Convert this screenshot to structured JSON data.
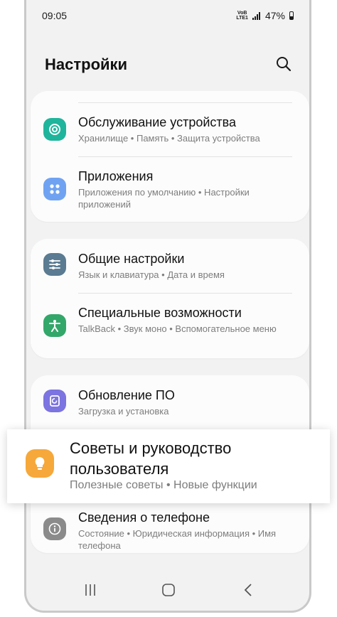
{
  "status_bar": {
    "time": "09:05",
    "network_top": "VoB",
    "network_bottom": "LTE1",
    "battery": "47%"
  },
  "header": {
    "title": "Настройки",
    "search_icon": "search-icon"
  },
  "colors": {
    "device_care": "#1fb59c",
    "apps": "#6fa3f2",
    "general": "#5a7b92",
    "accessibility": "#33a76a",
    "update": "#7c74e0",
    "tips": "#f6a83a",
    "about": "#8b8b8b"
  },
  "sections": {
    "device_care": {
      "title": "Обслуживание устройства",
      "subtitle": "Хранилище • Память • Защита устройства"
    },
    "apps": {
      "title": "Приложения",
      "subtitle": "Приложения по умолчанию • Настройки приложений"
    },
    "general": {
      "title": "Общие настройки",
      "subtitle": "Язык и клавиатура • Дата и время"
    },
    "accessibility": {
      "title": "Специальные возможности",
      "subtitle": "TalkBack • Звук моно • Вспомогательное меню"
    },
    "update": {
      "title": "Обновление ПО",
      "subtitle": "Загрузка и установка"
    },
    "tips": {
      "title": "Советы и руководство пользователя",
      "subtitle": "Полезные советы • Новые функции"
    },
    "about": {
      "title": "Сведения о телефоне",
      "subtitle": "Состояние • Юридическая информация • Имя телефона"
    }
  },
  "nav_bar": {
    "recent": "recent-apps-icon",
    "home": "home-icon",
    "back": "back-icon"
  }
}
